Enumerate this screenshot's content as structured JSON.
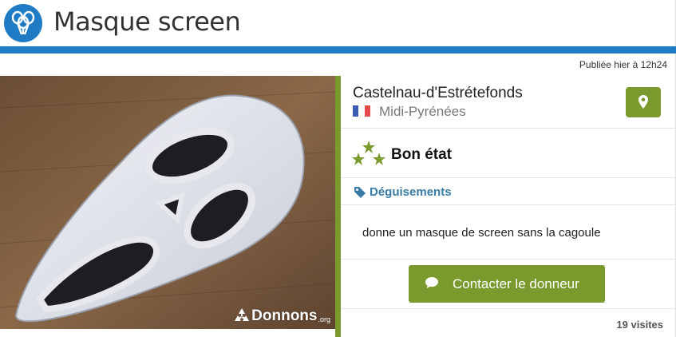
{
  "header": {
    "title": "Masque screen",
    "logo_icon": "balloons-icon",
    "accent_color": "#1e7bc4"
  },
  "listing": {
    "published": "Publiée hier à 12h24",
    "location": {
      "city": "Castelnau-d'Estrétefonds",
      "region": "Midi-Pyrénées",
      "flag_icon": "france-flag-icon",
      "map_button_icon": "map-pin-icon"
    },
    "condition": {
      "label": "Bon état",
      "icon": "three-stars-icon"
    },
    "category": {
      "label": "Déguisements",
      "icon": "tag-icon"
    },
    "description": "donne un masque de screen sans la cagoule",
    "contact_button": {
      "label": "Contacter le donneur",
      "icon": "chat-bubble-icon"
    },
    "visits": "19 visites",
    "photo_watermark": {
      "name": "Donnons",
      "suffix": ".org",
      "icon": "recycle-icon"
    }
  },
  "colors": {
    "green": "#7a9a2e",
    "blue": "#1e7bc4",
    "tag_blue": "#3a7ca5"
  }
}
